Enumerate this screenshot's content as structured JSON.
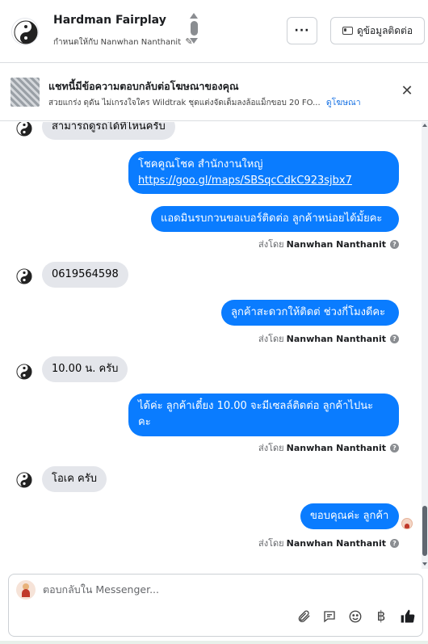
{
  "header": {
    "name": "Hardman Fairplay",
    "assigned_label": "กำหนดให้กับ",
    "assigned_to": "Nanwhan Nanthanit",
    "more_label": "···",
    "contact_label": "ดูข้อมูลติดต่อ"
  },
  "ad": {
    "title": "แชทนี้มีข้อความตอบกลับต่อโฆษณาของคุณ",
    "description": "สวยแกร่ง ดุดัน ไม่เกรงใจใคร Wildtrak ชุดแต่งจัดเต็มลงล้อแม็กขอบ 20 FO...",
    "link": "ดูโฆษณา",
    "close": "✕"
  },
  "messages": [
    {
      "dir": "in",
      "lines": [
        "สามารถดูรถได้ที่ไหนครับ"
      ]
    },
    {
      "dir": "out",
      "lines": [
        "โชคคูณโชค สำนักงานใหญ่"
      ],
      "link": "https://goo.gl/maps/SBSqcCdkC923sjbx7"
    },
    {
      "dir": "out",
      "lines": [
        "แอดมินรบกวนขอเบอร์ติดต่อ ลูกค้าหน่อยได้มั้ยคะ"
      ]
    },
    {
      "dir": "in",
      "lines": [
        "0619564598"
      ]
    },
    {
      "dir": "out",
      "lines": [
        "ลูกค้าสะดวกให้ติดต่ ช่วงกี่โมงดีคะ"
      ]
    },
    {
      "dir": "in",
      "lines": [
        "10.00 น. ครับ"
      ]
    },
    {
      "dir": "out",
      "lines": [
        "ได้ค่ะ ลูกค้าเดี๋ยง 10.00 จะมีเซลล์ติดต่อ ลูกค้าไปนะ",
        "คะ"
      ]
    },
    {
      "dir": "in",
      "lines": [
        "โอเค ครับ"
      ]
    },
    {
      "dir": "out",
      "lines": [
        "ขอบคุณค่ะ ลูกค้า"
      ]
    }
  ],
  "sent_by": {
    "label": "ส่งโดย",
    "name": "Nanwhan Nanthanit",
    "help": "?"
  },
  "composer": {
    "placeholder": "ตอบกลับใน Messenger..."
  },
  "colors": {
    "outgoing_bubble": "#0a7cff",
    "incoming_bubble": "#e4e6eb",
    "link": "#1b74e4"
  },
  "icons": [
    "paperclip-icon",
    "saved-reply-icon",
    "emoji-icon",
    "baht-icon",
    "thumbs-up-icon",
    "pencil-icon",
    "contact-card-icon",
    "close-icon",
    "yin-yang-icon"
  ]
}
